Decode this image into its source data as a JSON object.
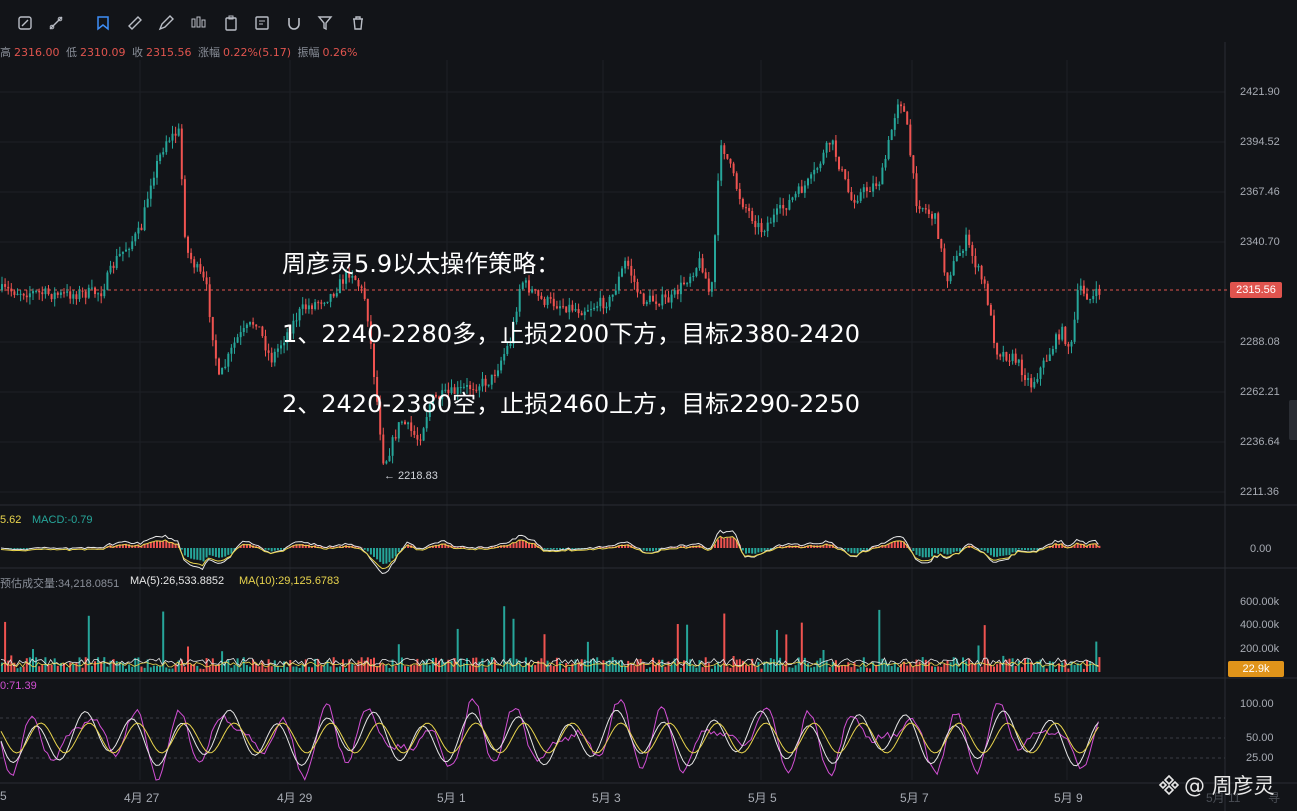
{
  "toolbar": {
    "tools": [
      {
        "name": "edit-icon"
      },
      {
        "name": "trendline-icon"
      },
      {
        "name": "bookmark-icon"
      },
      {
        "name": "ruler-icon"
      },
      {
        "name": "pen-icon"
      },
      {
        "name": "candle-icon"
      },
      {
        "name": "clipboard-icon"
      },
      {
        "name": "report-icon"
      },
      {
        "name": "magnet-icon"
      },
      {
        "name": "filter-icon"
      },
      {
        "name": "trash-icon"
      }
    ]
  },
  "ohlc": {
    "high_label": "高",
    "high": "2316.00",
    "low_label": "低",
    "low": "2310.09",
    "close_label": "收",
    "close": "2315.56",
    "change_label": "涨幅",
    "change": "0.22%(5.17)",
    "amp_label": "振幅",
    "amp": "0.26%"
  },
  "price_axis": {
    "labels": [
      "2421.90",
      "2394.52",
      "2367.46",
      "2340.70",
      "2288.08",
      "2262.21",
      "2236.64",
      "2211.36"
    ],
    "current": "2315.56",
    "current_color": "#e0544e"
  },
  "macd": {
    "dif_label": "5.62",
    "macd_label": "MACD:-0.79",
    "zero_label": "0.00"
  },
  "volume": {
    "label": "预估成交量:34,218.0851",
    "ma5": "MA(5):26,533.8852",
    "ma10": "MA(10):29,125.6783",
    "axis": [
      "600.00k",
      "400.00k",
      "200.00k"
    ],
    "current": "22.9k",
    "current_color": "#e0941a"
  },
  "oscillator": {
    "label": "0:71.39",
    "axis": [
      "100.00",
      "50.00",
      "25.00"
    ]
  },
  "x_axis": {
    "labels": [
      "5",
      "4月 27",
      "4月 29",
      "5月 1",
      "5月 3",
      "5月 5",
      "5月 7",
      "5月 9",
      "5月 11",
      "寻"
    ]
  },
  "overlay": {
    "title": "周彦灵5.9以太操作策略：",
    "line1": "1、2240-2280多，止损2200下方，目标2380-2420",
    "line2": "2、2420-2380空，止损2460上方，目标2290-2250"
  },
  "low_marker": "← 2218.83",
  "watermark": "@ 周彦灵",
  "colors": {
    "bull": "#26a69a",
    "bear": "#ef5350",
    "ma_yellow": "#e8d44d",
    "ma_white": "#e6e6e6",
    "osc_pink": "#d24fd4"
  }
}
